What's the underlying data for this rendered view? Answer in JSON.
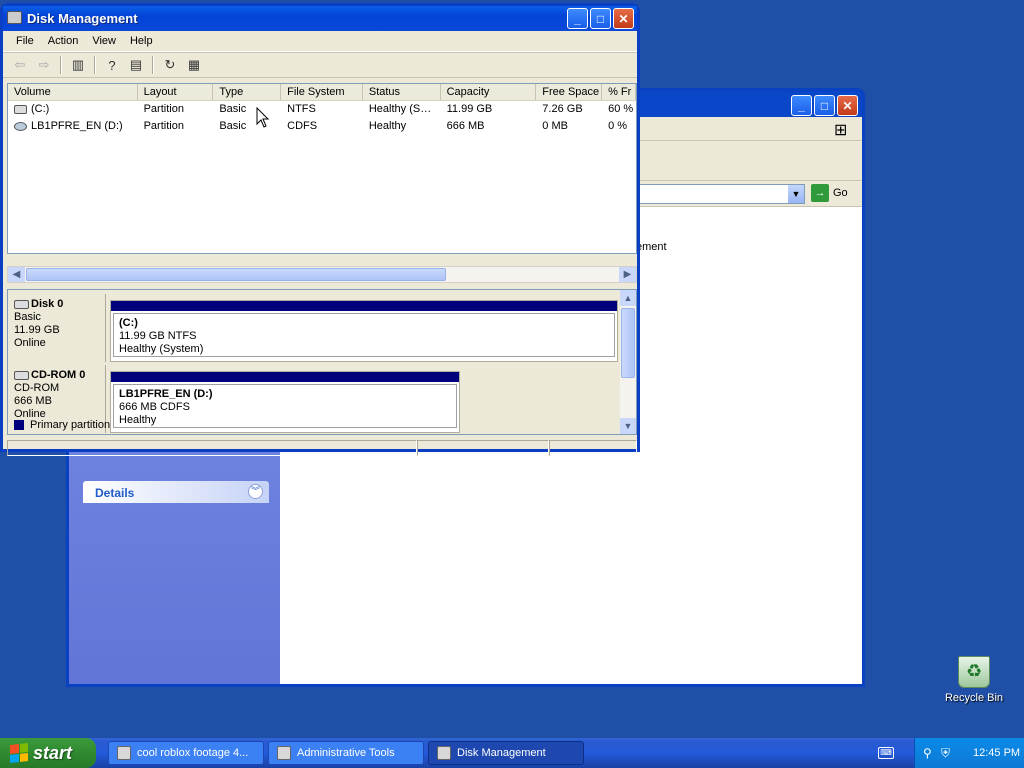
{
  "desktop": {
    "recycle_bin_label": "Recycle Bin"
  },
  "background_window": {
    "go_label": "Go",
    "content_fragment": "ement",
    "details_label": "Details"
  },
  "disk_management": {
    "title": "Disk Management",
    "menu": [
      "File",
      "Action",
      "View",
      "Help"
    ],
    "columns": [
      "Volume",
      "Layout",
      "Type",
      "File System",
      "Status",
      "Capacity",
      "Free Space",
      "% Fr"
    ],
    "volumes": [
      {
        "volume": "(C:)",
        "layout": "Partition",
        "type": "Basic",
        "fs": "NTFS",
        "status": "Healthy (S…",
        "capacity": "11.99 GB",
        "free": "7.26 GB",
        "pct": "60 %"
      },
      {
        "volume": "LB1PFRE_EN (D:)",
        "layout": "Partition",
        "type": "Basic",
        "fs": "CDFS",
        "status": "Healthy",
        "capacity": "666 MB",
        "free": "0 MB",
        "pct": "0 %"
      }
    ],
    "disks": [
      {
        "name": "Disk 0",
        "kind": "Basic",
        "size": "11.99 GB",
        "state": "Online",
        "partition": {
          "name": "(C:)",
          "detail": "11.99 GB NTFS",
          "status": "Healthy (System)"
        }
      },
      {
        "name": "CD-ROM 0",
        "kind": "CD-ROM",
        "size": "666 MB",
        "state": "Online",
        "partition": {
          "name": "LB1PFRE_EN  (D:)",
          "detail": "666 MB CDFS",
          "status": "Healthy"
        }
      }
    ],
    "legend_label": "Primary partition"
  },
  "taskbar": {
    "start_label": "start",
    "tasks": [
      {
        "label": "cool roblox footage 4..."
      },
      {
        "label": "Administrative Tools"
      },
      {
        "label": "Disk Management"
      }
    ],
    "clock": "12:45 PM"
  },
  "colors": {
    "desktop": "#1f4fa6",
    "partition_bar": "#00007c",
    "taskbar": "#245ad9",
    "start_button": "#2f8a2f"
  }
}
